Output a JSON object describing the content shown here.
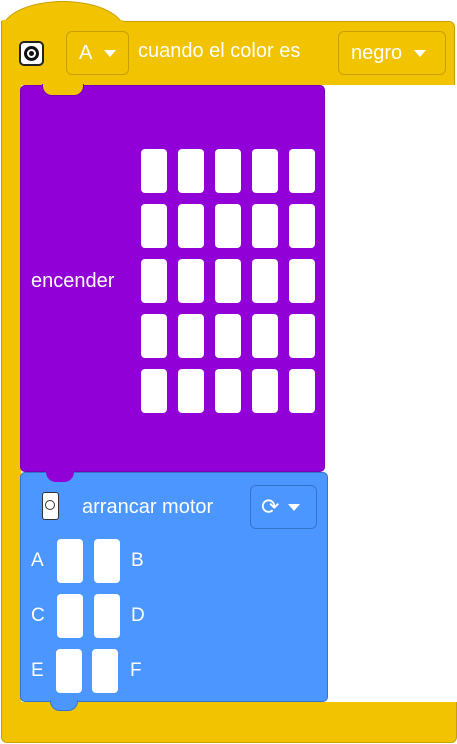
{
  "hat_block": {
    "port_dropdown": "A",
    "label": "cuando el color es",
    "color_dropdown": "negro"
  },
  "display_block": {
    "label": "encender",
    "grid_rows": 5,
    "grid_cols": 5
  },
  "motor_block": {
    "label": "arrancar motor",
    "direction_icon": "rotate-clockwise-icon",
    "direction_glyph": "⟳",
    "ports": [
      {
        "left": "A",
        "right": "B"
      },
      {
        "left": "C",
        "right": "D"
      },
      {
        "left": "E",
        "right": "F"
      }
    ]
  },
  "colors": {
    "hat": "#f2c300",
    "display": "#9100d6",
    "motor": "#4c97ff"
  }
}
